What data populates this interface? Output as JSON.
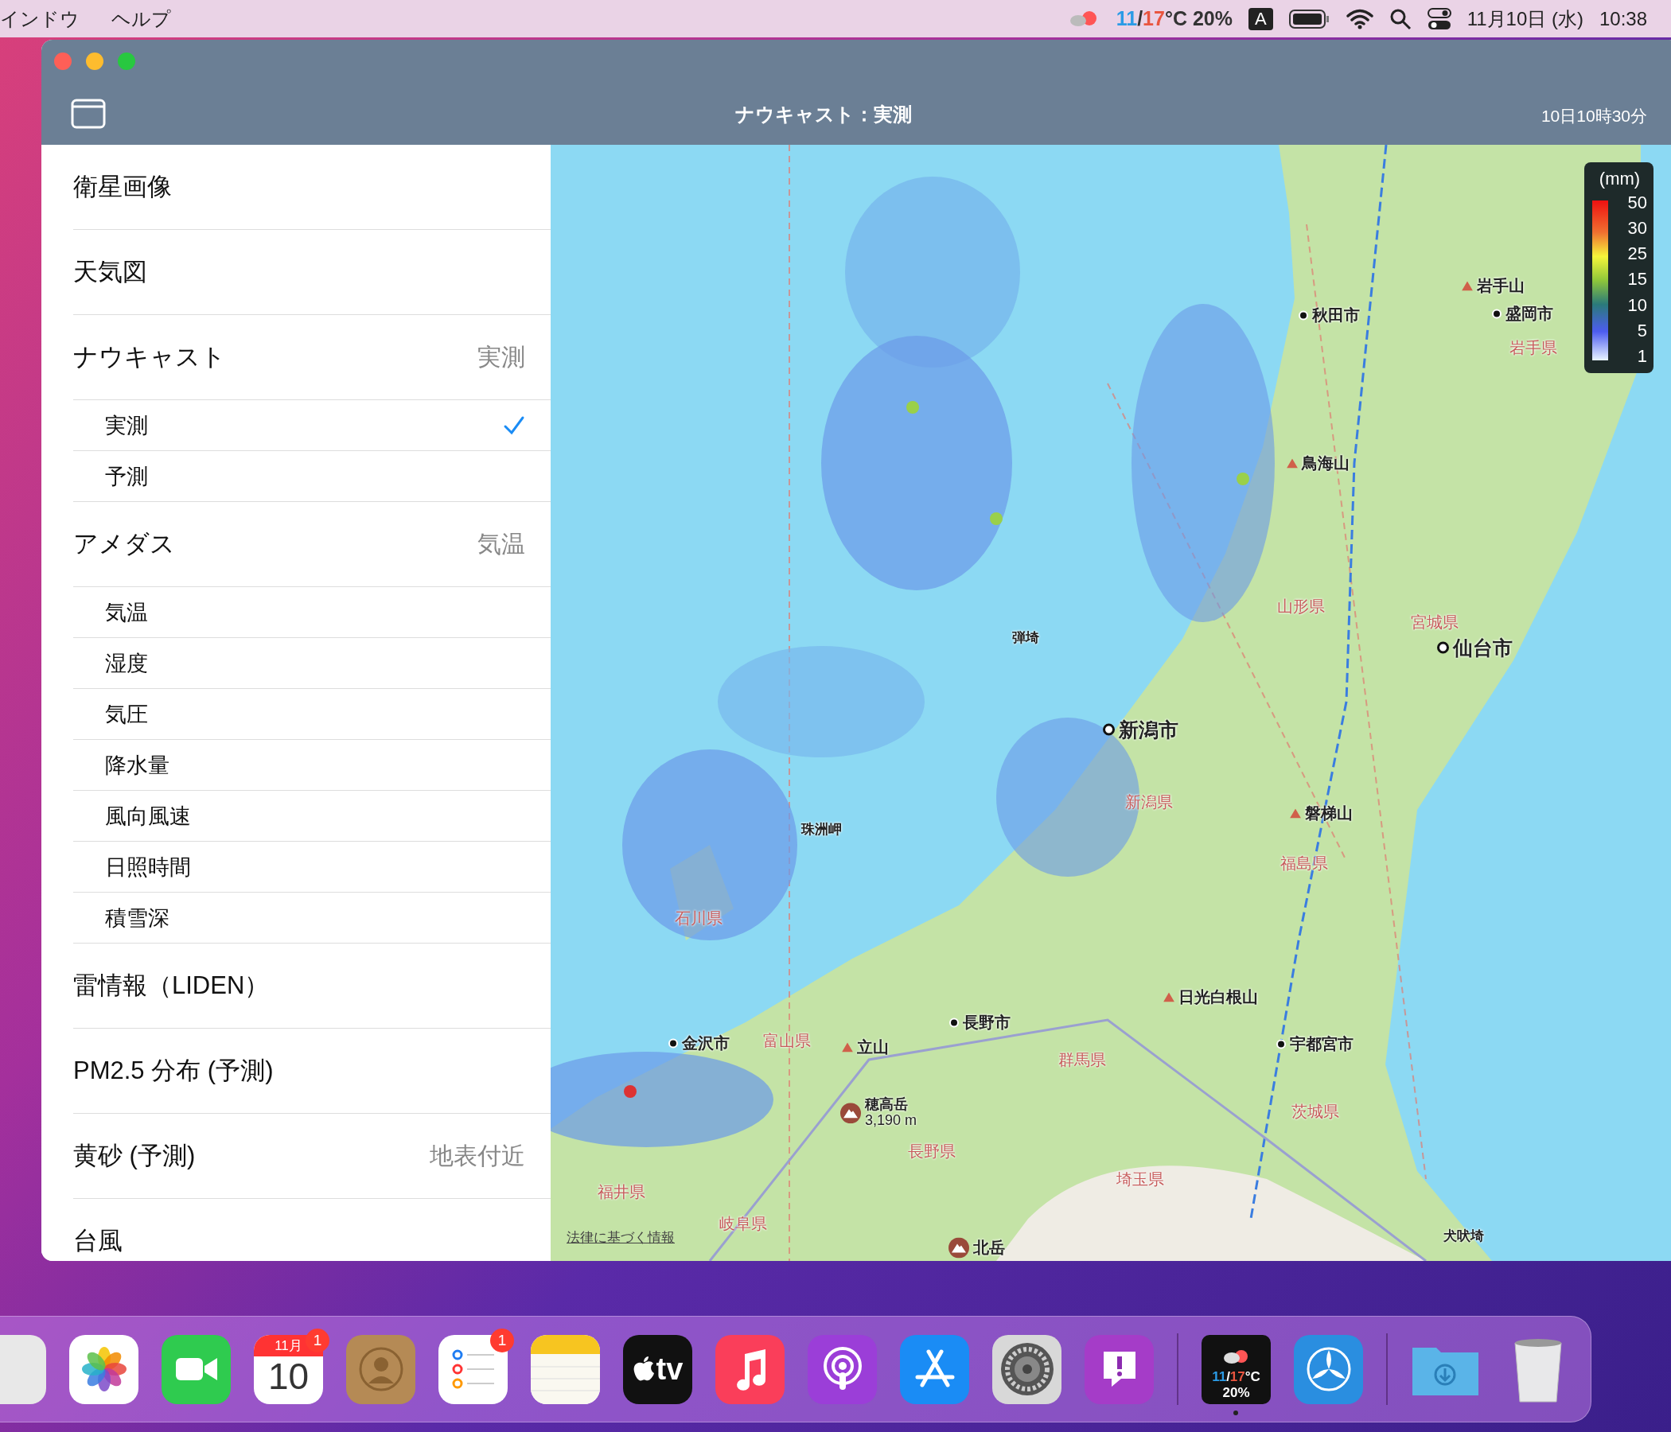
{
  "menu_bar": {
    "menus": [
      "インドウ",
      "ヘルプ"
    ],
    "weather": {
      "low": "11",
      "separator": "/",
      "high": "17",
      "unit": "°C",
      "precip": "20%"
    },
    "input_source": "A",
    "date": "11月10日 (水)",
    "time": "10:38"
  },
  "window": {
    "title": "ナウキャスト：実測",
    "timestamp": "10日10時30分"
  },
  "sidebar": {
    "items": [
      {
        "kind": "section",
        "label": "衛星画像"
      },
      {
        "kind": "section",
        "label": "天気図"
      },
      {
        "kind": "section",
        "label": "ナウキャスト",
        "value": "実測"
      },
      {
        "kind": "option",
        "label": "実測",
        "selected": true
      },
      {
        "kind": "option",
        "label": "予測",
        "selected": false
      },
      {
        "kind": "section",
        "label": "アメダス",
        "value": "気温"
      },
      {
        "kind": "option",
        "label": "気温",
        "selected": false
      },
      {
        "kind": "option",
        "label": "湿度",
        "selected": false
      },
      {
        "kind": "option",
        "label": "気圧",
        "selected": false
      },
      {
        "kind": "option",
        "label": "降水量",
        "selected": false
      },
      {
        "kind": "option",
        "label": "風向風速",
        "selected": false
      },
      {
        "kind": "option",
        "label": "日照時間",
        "selected": false
      },
      {
        "kind": "option",
        "label": "積雪深",
        "selected": false
      },
      {
        "kind": "section",
        "label": "雷情報（LIDEN）"
      },
      {
        "kind": "section",
        "label": "PM2.5 分布 (予測)"
      },
      {
        "kind": "section",
        "label": "黄砂 (予測)",
        "value": "地表付近"
      },
      {
        "kind": "section",
        "label": "台風"
      }
    ]
  },
  "map": {
    "legend": {
      "unit": "(mm)",
      "scale": [
        "50",
        "30",
        "25",
        "15",
        "10",
        "5",
        "1"
      ]
    },
    "labels": [
      {
        "kind": "city",
        "text": "秋田市"
      },
      {
        "kind": "mountain",
        "text": "岩手山"
      },
      {
        "kind": "city",
        "text": "盛岡市"
      },
      {
        "kind": "prefecture",
        "text": "岩手県"
      },
      {
        "kind": "mountain",
        "text": "鳥海山"
      },
      {
        "kind": "prefecture",
        "text": "山形県"
      },
      {
        "kind": "prefecture",
        "text": "宮城県"
      },
      {
        "kind": "major_city",
        "text": "仙台市"
      },
      {
        "kind": "cape",
        "text": "弾埼"
      },
      {
        "kind": "major_city",
        "text": "新潟市"
      },
      {
        "kind": "prefecture",
        "text": "新潟県"
      },
      {
        "kind": "mountain",
        "text": "磐梯山"
      },
      {
        "kind": "cape",
        "text": "珠洲岬"
      },
      {
        "kind": "prefecture",
        "text": "福島県"
      },
      {
        "kind": "prefecture",
        "text": "石川県"
      },
      {
        "kind": "mountain",
        "text": "日光白根山"
      },
      {
        "kind": "city",
        "text": "長野市"
      },
      {
        "kind": "city",
        "text": "金沢市"
      },
      {
        "kind": "prefecture",
        "text": "富山県"
      },
      {
        "kind": "mountain",
        "text": "立山"
      },
      {
        "kind": "city",
        "text": "宇都宮市"
      },
      {
        "kind": "prefecture",
        "text": "群馬県"
      },
      {
        "kind": "peak",
        "text": "穂高岳",
        "elevation": "3,190 m"
      },
      {
        "kind": "prefecture",
        "text": "茨城県"
      },
      {
        "kind": "prefecture",
        "text": "長野県"
      },
      {
        "kind": "prefecture",
        "text": "埼玉県"
      },
      {
        "kind": "prefecture",
        "text": "福井県"
      },
      {
        "kind": "prefecture",
        "text": "岐阜県"
      },
      {
        "kind": "cape",
        "text": "犬吠埼"
      },
      {
        "kind": "peak",
        "text": "北岳"
      }
    ],
    "legal_link": "法律に基づく情報"
  },
  "dock": {
    "items": [
      {
        "kind": "partial",
        "running": false
      },
      {
        "kind": "photos",
        "running": false
      },
      {
        "kind": "facetime",
        "running": false
      },
      {
        "kind": "calendar",
        "month": "11月",
        "day": "10",
        "badge": "1",
        "running": false
      },
      {
        "kind": "contacts",
        "running": false
      },
      {
        "kind": "reminders",
        "badge": "1",
        "running": false
      },
      {
        "kind": "notes",
        "running": false
      },
      {
        "kind": "tv",
        "label": "tv",
        "running": false
      },
      {
        "kind": "music",
        "running": false
      },
      {
        "kind": "podcasts",
        "running": false
      },
      {
        "kind": "appstore",
        "running": false
      },
      {
        "kind": "settings",
        "running": false
      },
      {
        "kind": "feedback",
        "running": false
      },
      {
        "kind": "divider"
      },
      {
        "kind": "weather",
        "low": "11",
        "separator": "/",
        "high": "17",
        "unit": "°C",
        "precip": "20%",
        "running": true
      },
      {
        "kind": "fan",
        "running": false
      },
      {
        "kind": "divider"
      },
      {
        "kind": "downloads",
        "running": false
      },
      {
        "kind": "trash",
        "running": false
      }
    ]
  }
}
